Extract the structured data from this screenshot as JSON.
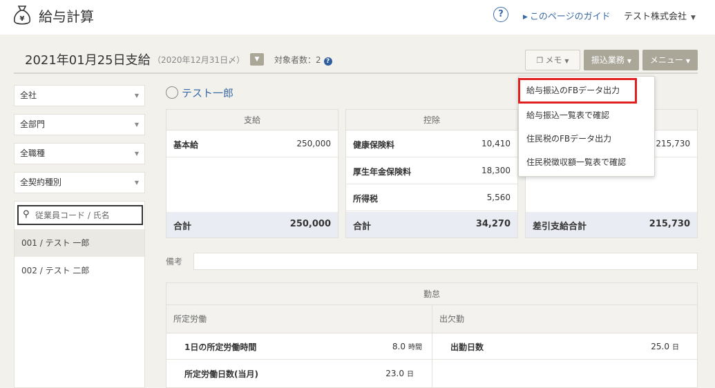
{
  "header": {
    "app_icon": "money-bag-icon",
    "app_title": "給与計算",
    "help_icon": "?",
    "guide_link": "このページのガイド",
    "company": "テスト株式会社"
  },
  "pay": {
    "title": "2021年01月25日支給",
    "closing": "（2020年12月31日〆）",
    "target_count": "対象者数：2",
    "memo_label": "メモ",
    "transfer_label": "振込業務",
    "menu_label": "メニュー"
  },
  "filters": [
    "全社",
    "全部門",
    "全職種",
    "全契約種別"
  ],
  "search": {
    "placeholder": "従業員コード / 氏名"
  },
  "employees": [
    {
      "label": "001 / テスト 一郎",
      "active": true
    },
    {
      "label": "002 / テスト 二郎",
      "active": false
    }
  ],
  "employee_name": "テスト一郎",
  "payment_card": {
    "title": "支給",
    "rows": [
      {
        "label": "基本給",
        "value": "250,000"
      }
    ],
    "total_label": "合計",
    "total_value": "250,000"
  },
  "deduction_card": {
    "title": "控除",
    "rows": [
      {
        "label": "健康保険料",
        "value": "10,410"
      },
      {
        "label": "厚生年金保険料",
        "value": "18,300"
      },
      {
        "label": "所得税",
        "value": "5,560"
      }
    ],
    "total_label": "合計",
    "total_value": "34,270"
  },
  "net_card": {
    "row_value": "215,730",
    "total_label": "差引支給合計",
    "total_value": "215,730"
  },
  "remark_label": "備考",
  "attendance": {
    "title": "勤怠",
    "left_title": "所定労働",
    "right_title": "出欠勤",
    "left_rows": [
      {
        "label": "1日の所定労働時間",
        "value": "8.0",
        "unit": "時間"
      },
      {
        "label": "所定労働日数(当月)",
        "value": "23.0",
        "unit": "日"
      }
    ],
    "right_rows": [
      {
        "label": "出勤日数",
        "value": "25.0",
        "unit": "日"
      }
    ]
  },
  "transfer_menu": {
    "items": [
      "給与振込のFBデータ出力",
      "給与振込一覧表で確認",
      "住民税のFBデータ出力",
      "住民税徴収額一覧表で確認"
    ],
    "highlight_color": "#e02020"
  }
}
